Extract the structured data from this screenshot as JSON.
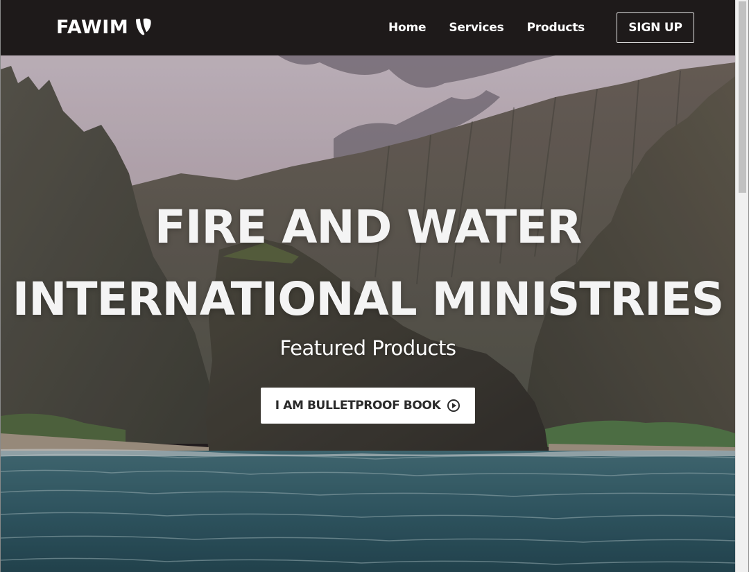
{
  "navbar": {
    "brand_text": "FAWIM",
    "brand_icon": "typo3-logo-icon",
    "links": [
      "Home",
      "Services",
      "Products"
    ],
    "signup_label": "SIGN UP"
  },
  "hero": {
    "title_line1": "FIRE AND WATER",
    "title_line2": "INTERNATIONAL MINISTRIES",
    "subtitle": "Featured Products",
    "cta_label": "I AM BULLETPROOF BOOK",
    "cta_icon": "play-circle-icon"
  },
  "colors": {
    "navbar_bg": "#1e1a1a",
    "text": "#ffffff",
    "cta_bg": "#ffffff",
    "cta_text": "#2b2b2b"
  }
}
